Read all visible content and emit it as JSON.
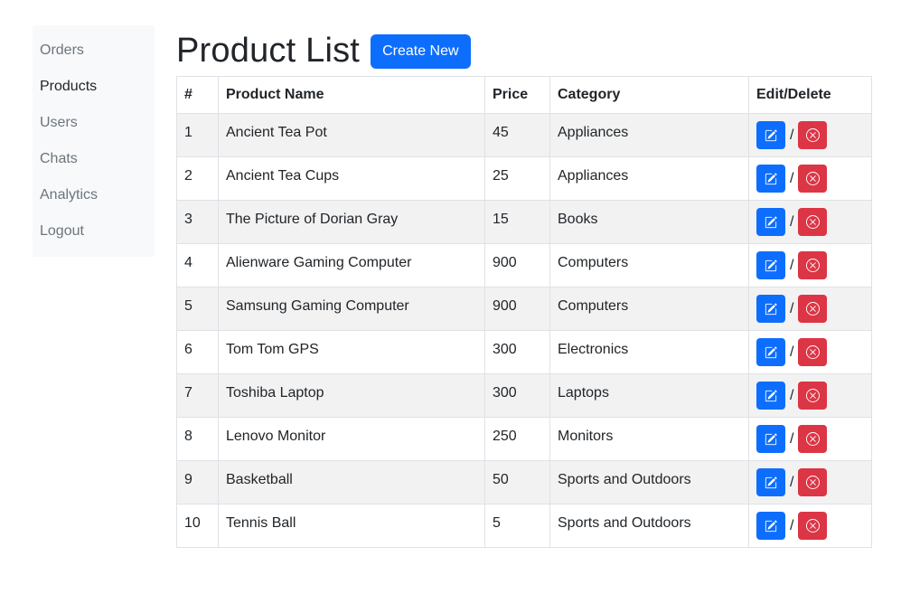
{
  "sidebar": {
    "items": [
      {
        "label": "Orders"
      },
      {
        "label": "Products"
      },
      {
        "label": "Users"
      },
      {
        "label": "Chats"
      },
      {
        "label": "Analytics"
      },
      {
        "label": "Logout"
      }
    ],
    "active": "Products"
  },
  "header": {
    "title": "Product List",
    "create_label": "Create New"
  },
  "table": {
    "headers": [
      "#",
      "Product Name",
      "Price",
      "Category",
      "Edit/Delete"
    ],
    "separator": "/",
    "rows": [
      {
        "num": "1",
        "name": "Ancient Tea Pot",
        "price": "45",
        "category": "Appliances"
      },
      {
        "num": "2",
        "name": "Ancient Tea Cups",
        "price": "25",
        "category": "Appliances"
      },
      {
        "num": "3",
        "name": "The Picture of Dorian Gray",
        "price": "15",
        "category": "Books"
      },
      {
        "num": "4",
        "name": "Alienware Gaming Computer",
        "price": "900",
        "category": "Computers"
      },
      {
        "num": "5",
        "name": "Samsung Gaming Computer",
        "price": "900",
        "category": "Computers"
      },
      {
        "num": "6",
        "name": "Tom Tom GPS",
        "price": "300",
        "category": "Electronics"
      },
      {
        "num": "7",
        "name": "Toshiba Laptop",
        "price": "300",
        "category": "Laptops"
      },
      {
        "num": "8",
        "name": "Lenovo Monitor",
        "price": "250",
        "category": "Monitors"
      },
      {
        "num": "9",
        "name": "Basketball",
        "price": "50",
        "category": "Sports and Outdoors"
      },
      {
        "num": "10",
        "name": "Tennis Ball",
        "price": "5",
        "category": "Sports and Outdoors"
      }
    ]
  },
  "icons": {
    "edit": "pencil-square-icon",
    "delete": "x-circle-icon"
  },
  "colors": {
    "primary": "#0d6efd",
    "danger": "#dc3545",
    "stripe": "#f2f2f2",
    "sidebar_bg": "#f8f9fa"
  }
}
